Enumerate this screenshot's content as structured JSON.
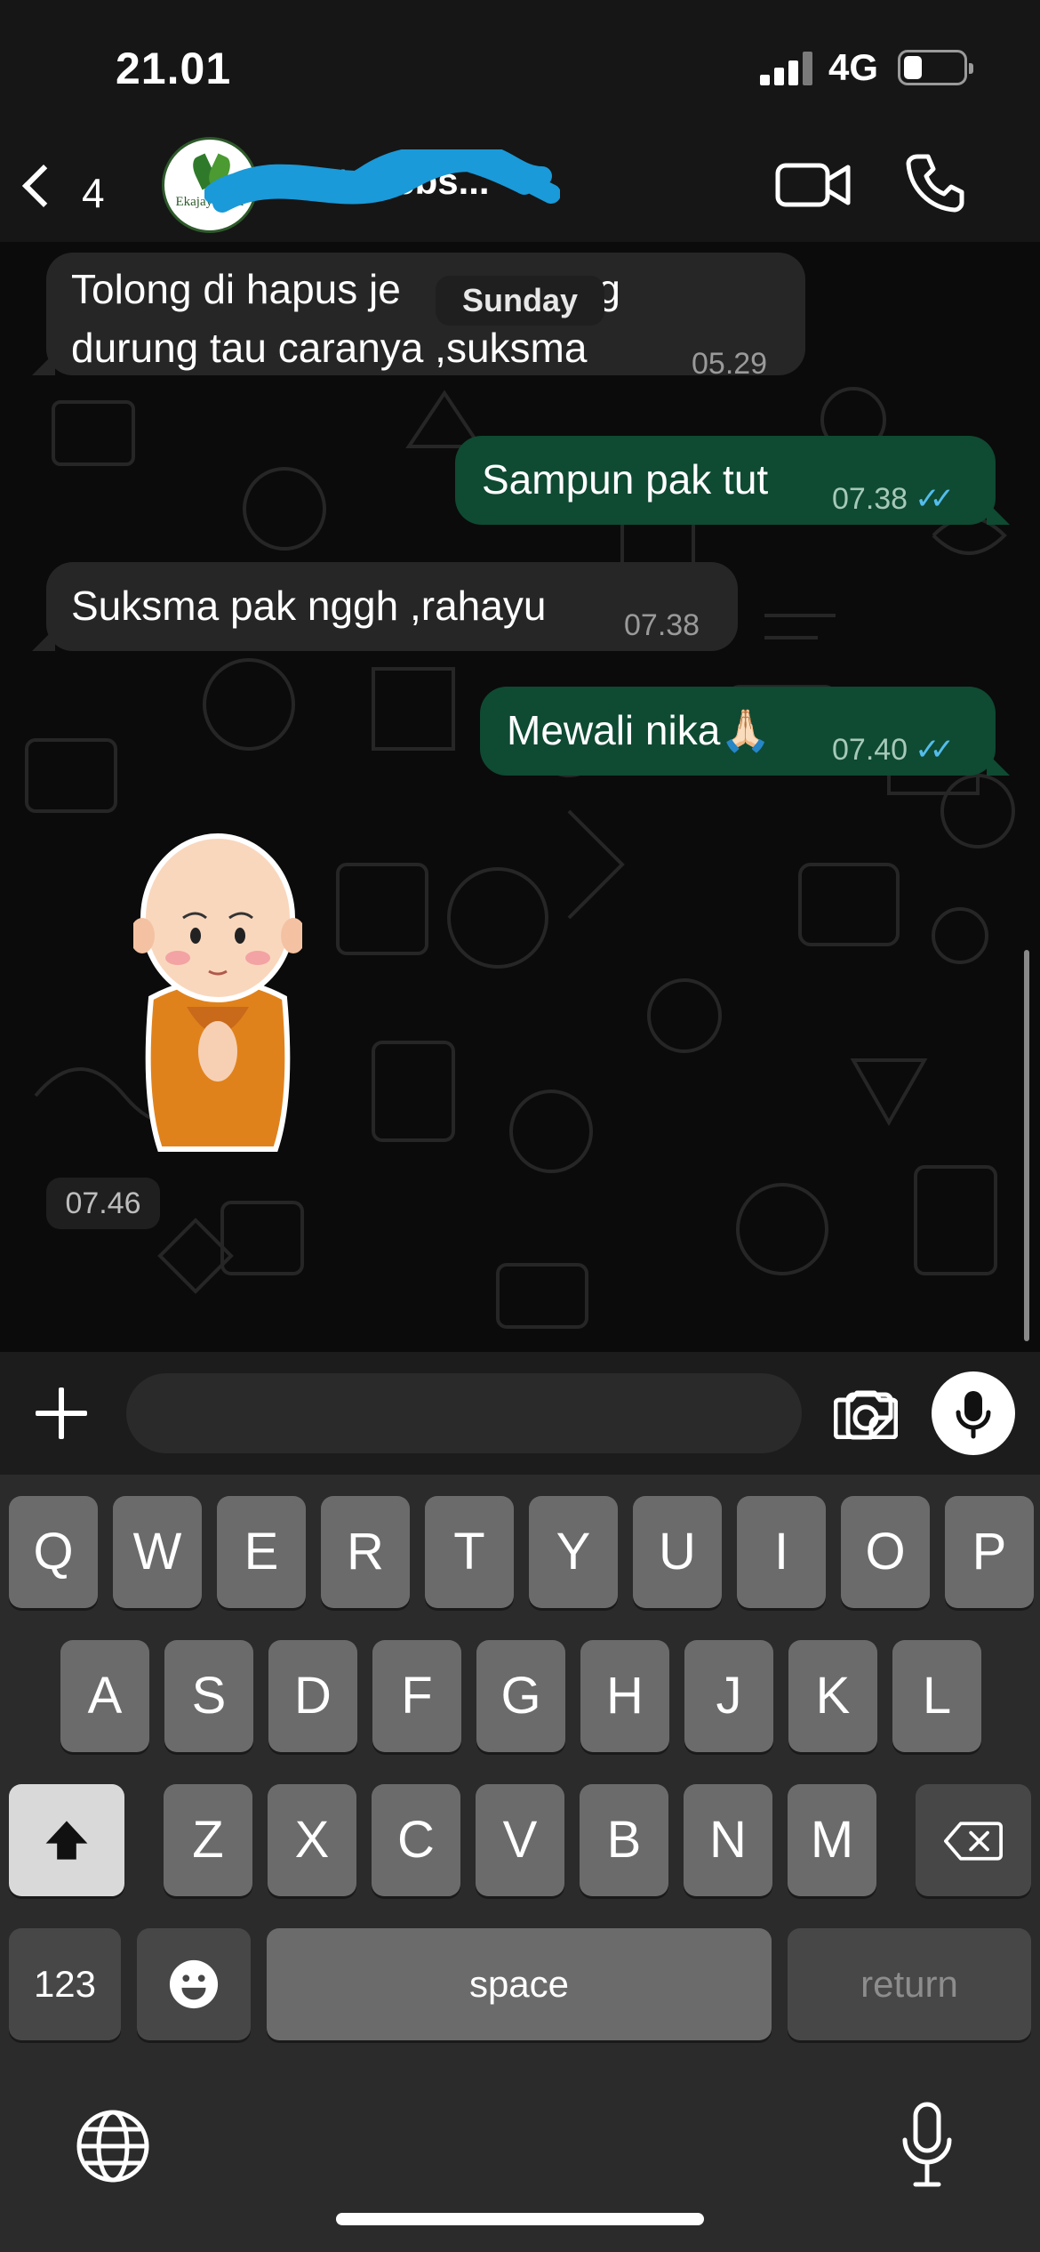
{
  "status_bar": {
    "time": "21.01",
    "network": "4G",
    "battery_level": 0.25
  },
  "header": {
    "back_count": "4",
    "avatar_text": "Ekajaya Asri",
    "chat_name": "ient Webs..."
  },
  "chat": {
    "date_chip": "Sunday",
    "messages": [
      {
        "direction": "in",
        "text_line1": "Tolong di hapus je",
        "text_line1_end": "ng",
        "text_line2": "durung tau caranya ,suksma",
        "time": "05.29"
      },
      {
        "direction": "out",
        "text": "Sampun pak tut",
        "time": "07.38",
        "status": "read"
      },
      {
        "direction": "in",
        "text": "Suksma pak nggh ,rahayu",
        "time": "07.38"
      },
      {
        "direction": "out",
        "text": "Mewali nika🙏🏻",
        "time": "07.40",
        "status": "read"
      },
      {
        "direction": "in",
        "type": "sticker",
        "time": "07.46"
      }
    ]
  },
  "input_bar": {
    "placeholder": ""
  },
  "keyboard": {
    "row1": [
      "Q",
      "W",
      "E",
      "R",
      "T",
      "Y",
      "U",
      "I",
      "O",
      "P"
    ],
    "row2": [
      "A",
      "S",
      "D",
      "F",
      "G",
      "H",
      "J",
      "K",
      "L"
    ],
    "row3": [
      "Z",
      "X",
      "C",
      "V",
      "B",
      "N",
      "M"
    ],
    "numbers_label": "123",
    "space_label": "space",
    "return_label": "return"
  },
  "colors": {
    "outgoing_bubble": "#0f4a33",
    "incoming_bubble": "#262626",
    "read_ticks": "#53bdeb"
  }
}
